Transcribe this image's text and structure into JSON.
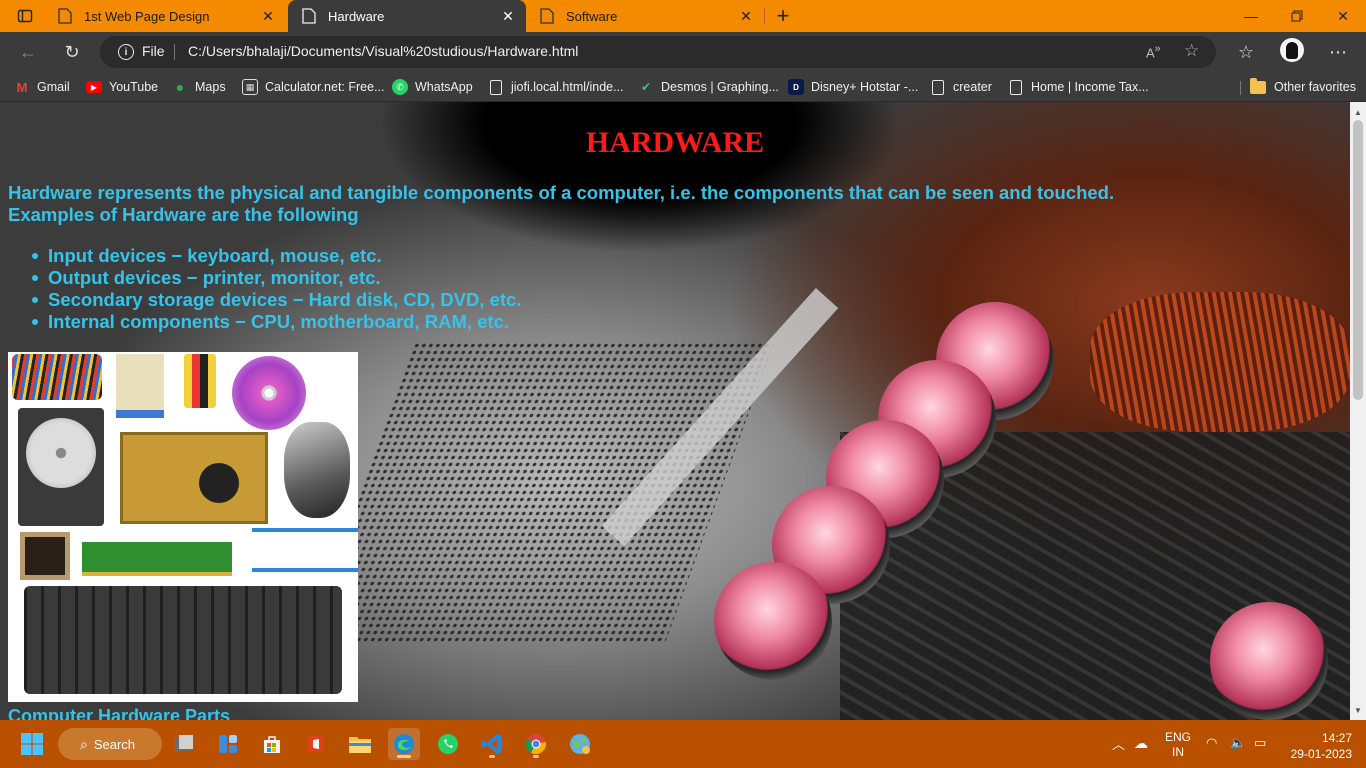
{
  "browser": {
    "tabs": [
      {
        "title": "1st Web Page Design",
        "active": false
      },
      {
        "title": "Hardware",
        "active": true
      },
      {
        "title": "Software",
        "active": false
      }
    ],
    "address": {
      "scheme": "File",
      "url": "C:/Users/bhalaji/Documents/Visual%20studious/Hardware.html"
    },
    "favorites": [
      {
        "label": "Gmail",
        "icon": "gmail-icon"
      },
      {
        "label": "YouTube",
        "icon": "youtube-icon"
      },
      {
        "label": "Maps",
        "icon": "maps-icon"
      },
      {
        "label": "Calculator.net: Free...",
        "icon": "calculator-icon"
      },
      {
        "label": "WhatsApp",
        "icon": "whatsapp-icon"
      },
      {
        "label": "jiofi.local.html/inde...",
        "icon": "page-icon"
      },
      {
        "label": "Desmos | Graphing...",
        "icon": "desmos-icon"
      },
      {
        "label": "Disney+ Hotstar -...",
        "icon": "hotstar-icon"
      },
      {
        "label": "creater",
        "icon": "page-icon"
      },
      {
        "label": "Home | Income Tax...",
        "icon": "page-icon"
      }
    ],
    "other_favorites": "Other favorites"
  },
  "page": {
    "title": "HARDWARE",
    "intro_line1": "Hardware represents the physical and tangible components of a computer, i.e. the components that can be seen and touched.",
    "intro_line2": "Examples of Hardware are the following",
    "items": [
      "Input devices − keyboard, mouse, etc.",
      "Output devices − printer, monitor, etc.",
      "Secondary storage devices − Hard disk, CD, DVD, etc.",
      "Internal components − CPU, motherboard, RAM, etc."
    ],
    "sub_heading": "Computer Hardware Parts"
  },
  "taskbar": {
    "search_label": "Search",
    "apps": [
      "task-view-icon",
      "widgets-icon",
      "store-icon",
      "office-icon",
      "file-explorer-icon",
      "edge-icon",
      "whatsapp-icon",
      "vscode-icon",
      "chrome-icon",
      "network-globe-icon"
    ],
    "language": "ENG",
    "region": "IN",
    "time": "14:27",
    "date": "29-01-2023"
  },
  "colors": {
    "accent_orange": "#f38a00",
    "taskbar": "#b85000",
    "heading_red": "#ff1a1a",
    "text_cyan": "#36c3ea"
  }
}
